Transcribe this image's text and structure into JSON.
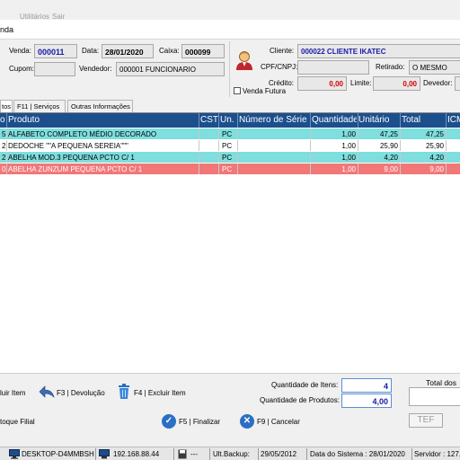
{
  "menu": [
    "Utilitários",
    "Sair"
  ],
  "window": {
    "title": "nda"
  },
  "sale": {
    "venda_label": "Venda:",
    "venda_value": "000011",
    "data_label": "Data:",
    "data_value": "28/01/2020",
    "caixa_label": "Caixa:",
    "caixa_value": "000099",
    "cupom_label": "Cupom:",
    "cupom_value": "",
    "vendedor_label": "Vendedor:",
    "vendedor_value": "000001  FUNCIONARIO"
  },
  "client": {
    "cliente_label": "Cliente:",
    "cliente_value": "000022  CLIENTE IKATEC",
    "cpf_label": "CPF/CNPJ:",
    "cpf_value": "",
    "retirado_label": "Retirado:",
    "retirado_value": "O MESMO",
    "credito_label": "Crédito:",
    "credito_value": "0,00",
    "limite_label": "Limite:",
    "limite_value": "0,00",
    "devedor_label": "Devedor:",
    "venda_futura_label": "Venda Futura"
  },
  "tabs": [
    "tos",
    "F11 | Serviços",
    "Outras Informações"
  ],
  "grid": {
    "headers": [
      "o",
      "Produto",
      "CST",
      "Un.",
      "Número de Série",
      "Quantidade",
      "Unitário",
      "Total",
      "ICM"
    ],
    "rows": [
      {
        "seq": "5",
        "produto": "ALFABETO COMPLETO MÉDIO DECORADO",
        "un": "PC",
        "qtd": "1,00",
        "unit": "47,25",
        "total": "47,25"
      },
      {
        "seq": "2",
        "produto": "DEDOCHE \"\"A PEQUENA SEREIA\"\"\"",
        "un": "PC",
        "qtd": "1,00",
        "unit": "25,90",
        "total": "25,90"
      },
      {
        "seq": "2",
        "produto": "ABELHA MOD.3 PEQUENA PCTO C/ 1",
        "un": "PC",
        "qtd": "1,00",
        "unit": "4,20",
        "total": "4,20"
      },
      {
        "seq": "0",
        "produto": "ABELHA ZUNZUM PEQUENA PCTO C/ 1",
        "un": "PC",
        "qtd": "1,00",
        "unit": "9,00",
        "total": "9,00"
      }
    ],
    "row_colors": [
      "#7fdede",
      "#ffffff",
      "#7fdede",
      "#f27777"
    ]
  },
  "bottom": {
    "excluir_item": "luir Item",
    "devolucao": "F3 | Devolução",
    "f4_excluir": "F4 | Excluir Item",
    "estoque_filial": "toque Filial",
    "qtd_itens_label": "Quantidade de Itens:",
    "qtd_itens_value": "4",
    "qtd_produtos_label": "Quantidade de Produtos:",
    "qtd_produtos_value": "4,00",
    "total_label": "Total dos",
    "finalizar": "F5 | Finalizar",
    "cancelar": "F9 | Cancelar",
    "tef": "TEF"
  },
  "statusbar": {
    "host": "DESKTOP-D4MMBSH",
    "ip": "192.168.88.44",
    "dashes": "---",
    "ult_backup_label": "Ult.Backup:",
    "ult_backup_value": "29/05/2012",
    "data_sistema": "Data do Sistema : 28/01/2020",
    "servidor": "Servidor : 127."
  }
}
